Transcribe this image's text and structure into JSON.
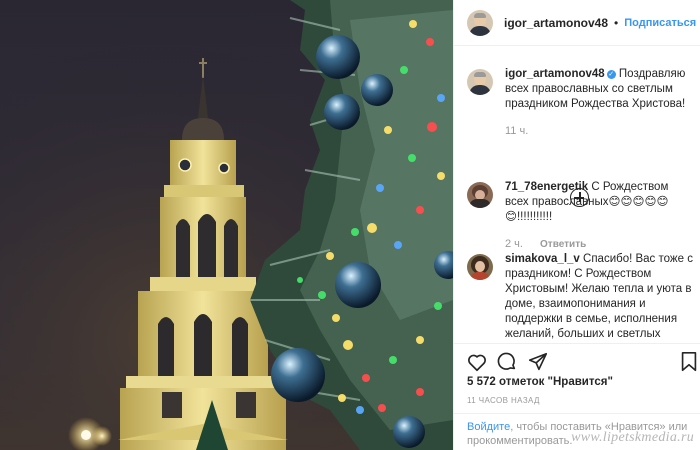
{
  "post": {
    "username": "igor_artamonov48",
    "follow_label": "Подписаться",
    "separator": "•"
  },
  "caption": {
    "username": "igor_artamonov48",
    "text": "Поздравляю всех православных со светлым праздником Рождества Христова!",
    "time": "11 ч."
  },
  "comments": [
    {
      "username": "71_78energetik",
      "text": "С Рождеством всех православных😊😊😊😊😊😊!!!!!!!!!!!",
      "time": "2 ч.",
      "reply_label": "Ответить"
    },
    {
      "username": "simakova_l_v",
      "text": "Спасибо! Вас тоже с праздником! С Рождеством Христовым! Желаю тепла и уюта в доме, взаимопонимания и поддержки в семье, исполнения желаний, больших и светлых целей,"
    }
  ],
  "likes": "5 572 отметок \"Нравится\"",
  "posted_ago": "11 ЧАСОВ НАЗАД",
  "login_prompt": {
    "link_text": "Войдите",
    "text": ", чтобы поставить «Нравится» или прокомментировать."
  },
  "watermark": "www.lipetskmedia.ru",
  "icons": {
    "like": "heart-icon",
    "comment": "comment-icon",
    "share": "share-icon",
    "save": "bookmark-icon",
    "load_more": "plus-circle-icon",
    "verified": "verified-badge-icon"
  },
  "colors": {
    "link": "#3897f0",
    "text": "#262626",
    "muted": "#999999",
    "border": "#efefef"
  }
}
